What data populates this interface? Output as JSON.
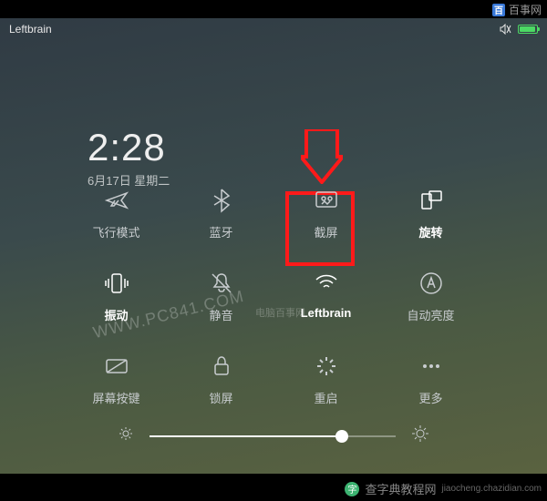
{
  "status": {
    "left": "Leftbrain"
  },
  "clock": {
    "time": "2:28",
    "date": "6月17日 星期二"
  },
  "tiles": {
    "airplane": {
      "label": "飞行模式"
    },
    "bluetooth": {
      "label": "蓝牙"
    },
    "screenshot": {
      "label": "截屏"
    },
    "rotation": {
      "label": "旋转"
    },
    "vibrate": {
      "label": "振动"
    },
    "mute": {
      "label": "静音"
    },
    "wifi": {
      "label": "Leftbrain"
    },
    "autobright": {
      "label": "自动亮度"
    },
    "softkeys": {
      "label": "屏幕按键"
    },
    "lock": {
      "label": "锁屏"
    },
    "reboot": {
      "label": "重启"
    },
    "more": {
      "label": "更多"
    }
  },
  "brightness": {
    "value": 78
  },
  "watermarks": {
    "diag": "WWW.PC841.COM",
    "center": "电脑百事网",
    "top_right": "百事网",
    "bottom": "查字典教程网",
    "bottom_url": "jiaocheng.chazidian.com"
  }
}
